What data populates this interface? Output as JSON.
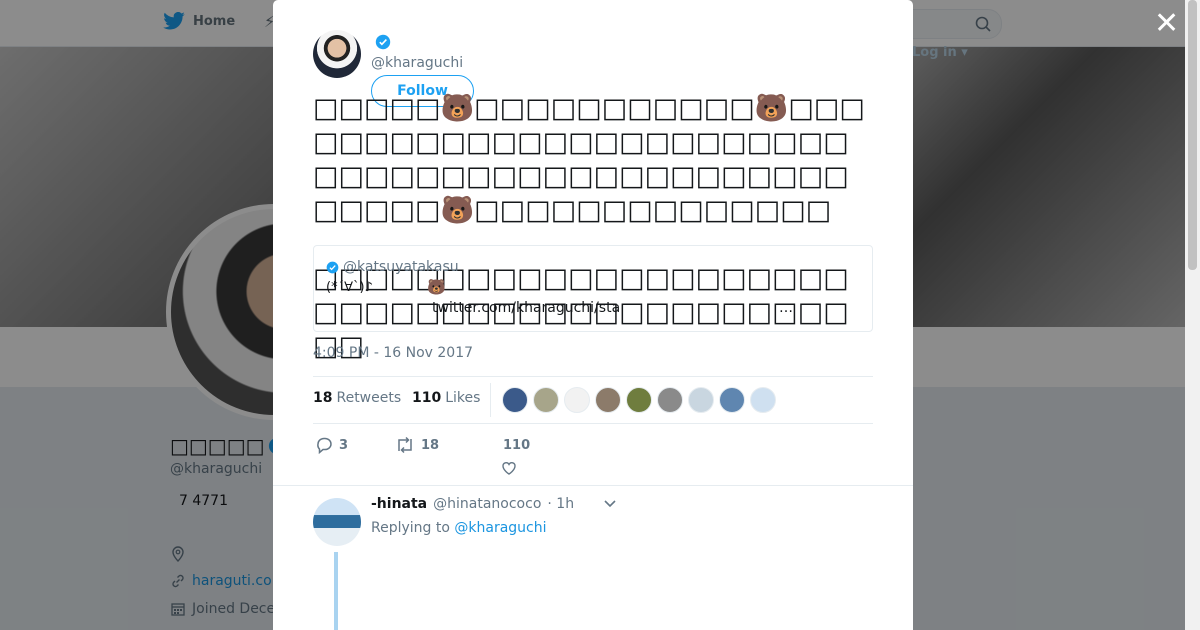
{
  "nav": {
    "home_label": "Home",
    "login_label": "Log in"
  },
  "profile": {
    "name": "□□□□□",
    "handle": "@kharaguchi",
    "stat": "7 4771",
    "url": "haraguti.co",
    "joined": "Joined Dece"
  },
  "tweet": {
    "author_handle": "@kharaguchi",
    "follow_label": "Follow",
    "text": "□□□□□🐻□□□□□□□□□□□🐻□□□□□□□□□□□□□□□□□□□□□□□□□□□□□□□□□□□□□□□□□□□□□□□□□□🐻□□□□□□□□□□□□□□\n\n□□□□□□□□□□□□□□□□□□□□□□□□□□□□□□□□□□□□□□□□□□□□",
    "quote": {
      "handle": "@katsuyatakasu",
      "kaomoji": "(*´∀`)♪",
      "bear": "🐻",
      "link": "twitter.com/kharaguchi/sta",
      "ellipsis": "…"
    },
    "timestamp": "4:09 PM - 16 Nov 2017",
    "retweets_count": "18",
    "retweets_label": "Retweets",
    "likes_count": "110",
    "likes_label": "Likes",
    "actions": {
      "reply_count": "3",
      "retweet_count": "18",
      "like_count": "110"
    }
  },
  "likers": [
    {
      "color": "#3b5a8a"
    },
    {
      "color": "#a7a58a"
    },
    {
      "color": "#f2f2f2"
    },
    {
      "color": "#8c7b6a"
    },
    {
      "color": "#6f7d3e"
    },
    {
      "color": "#8a8a8a"
    },
    {
      "color": "#c9d6e0"
    },
    {
      "color": "#5f86b0"
    },
    {
      "color": "#cfe0f0"
    }
  ],
  "reply": {
    "name": "-hinata",
    "handle": "@hinatanococo",
    "time": "· 1h",
    "replying_prefix": "Replying to",
    "replying_to": "@kharaguchi"
  },
  "icons": {
    "twitter": "twitter-bird-icon",
    "search": "search-icon",
    "close": "close-icon",
    "verified": "verified-badge-icon",
    "reply": "reply-icon",
    "retweet": "retweet-icon",
    "like": "heart-icon",
    "caret": "chevron-down-icon",
    "location": "location-icon",
    "link": "link-icon",
    "calendar": "calendar-icon"
  },
  "colors": {
    "accent": "#1da1f2",
    "link": "#1b95e0",
    "muted": "#657786"
  }
}
